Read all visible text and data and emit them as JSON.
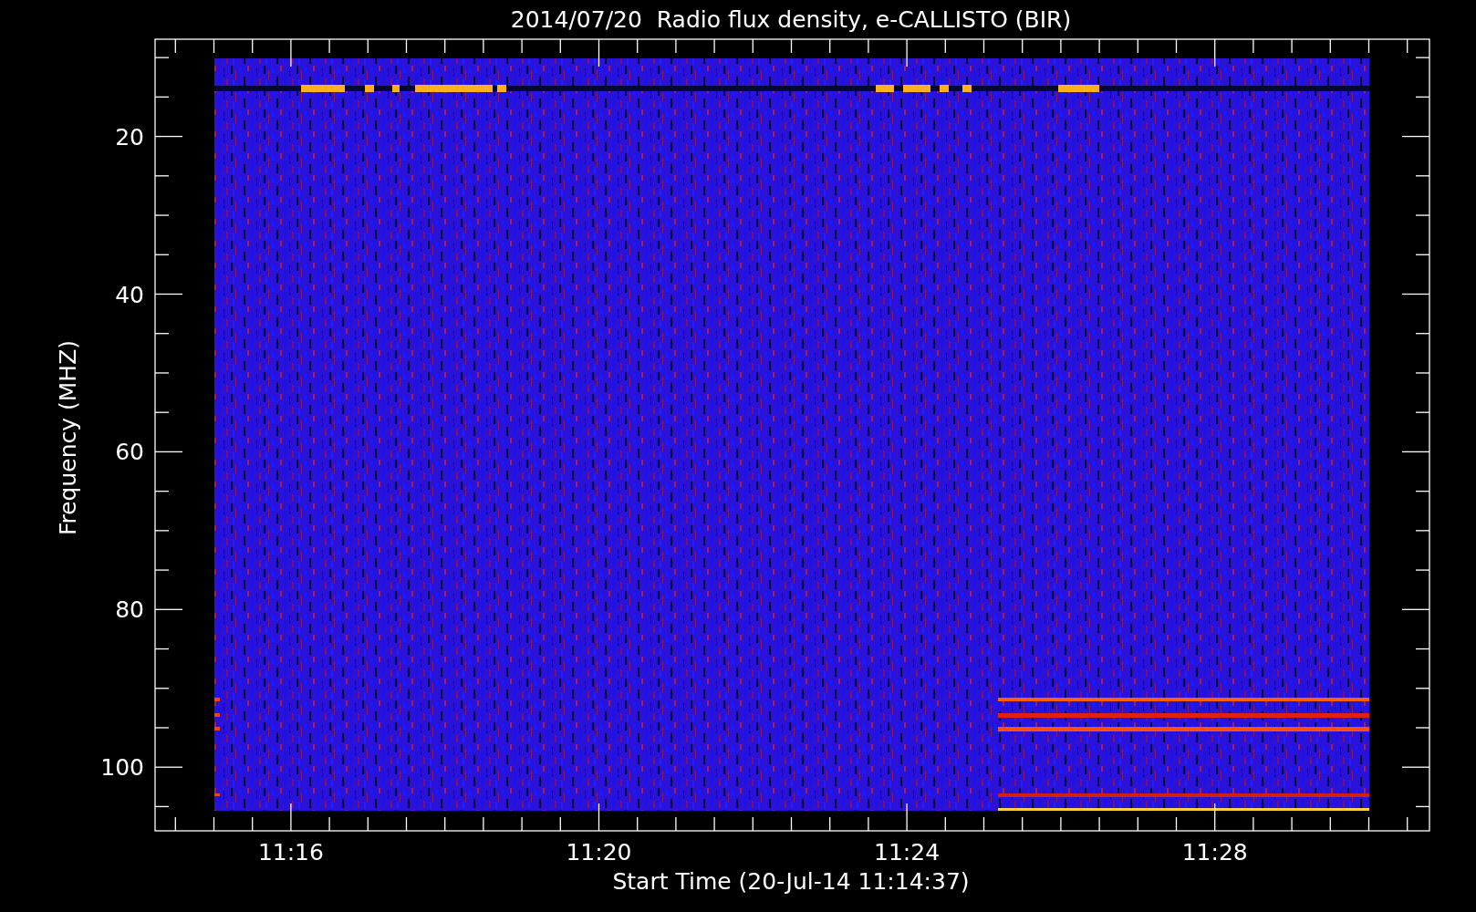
{
  "title": "2014/07/20  Radio flux density, e-CALLISTO (BIR)",
  "y_axis": {
    "label": "Frequency (MHZ)",
    "ticks": [
      "20",
      "40",
      "60",
      "80",
      "100"
    ]
  },
  "x_axis": {
    "label": "Start Time (20-Jul-14 11:14:37)",
    "ticks": [
      "11:16",
      "11:20",
      "11:24",
      "11:28"
    ]
  }
}
